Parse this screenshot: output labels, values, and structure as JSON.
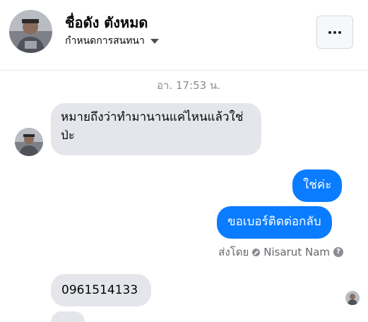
{
  "header": {
    "name": "ชื่อดัง ตังหมด",
    "subtitle": "กำหนดการสนทนา",
    "avatar_icon": "profile-photo",
    "more_icon": "more-options-icon"
  },
  "conversation": {
    "timestamp": "อา. 17:53 น.",
    "messages": [
      {
        "side": "in",
        "text": "หมายถึงว่าทำมานานแค่ไหนแล้วใช่ป่ะ"
      },
      {
        "side": "out",
        "text": "ใช่ค่ะ"
      },
      {
        "side": "out",
        "text": "ขอเบอร์ติดต่อกลับ"
      },
      {
        "side": "in",
        "text": "0961514133"
      },
      {
        "side": "in",
        "text": ""
      }
    ],
    "sent_by": {
      "prefix": "ส่งโดย",
      "name": "Nisarut Nam"
    }
  },
  "colors": {
    "outgoing_bubble": "#0a7cff",
    "incoming_bubble": "#e4e6eb",
    "secondary_text": "#65676b"
  }
}
